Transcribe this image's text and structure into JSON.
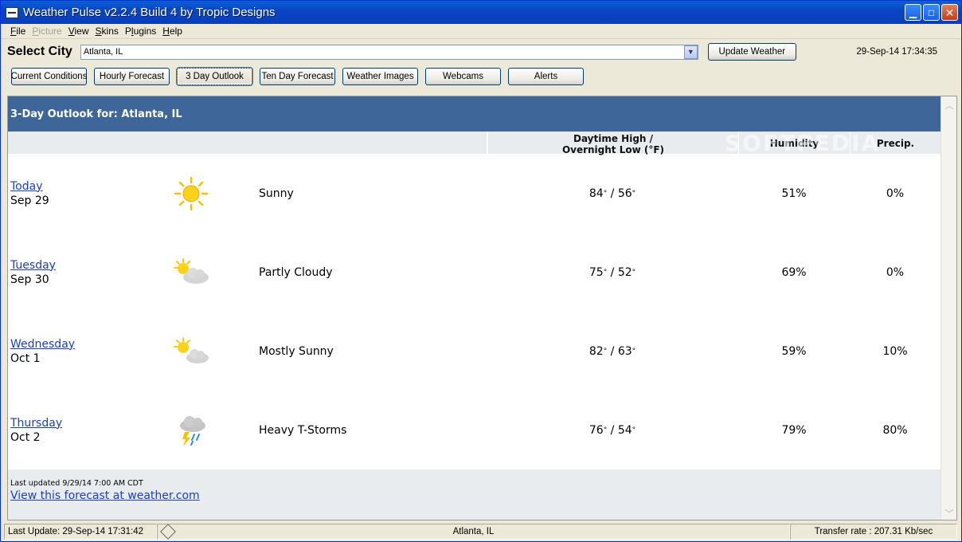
{
  "window": {
    "title": "Weather Pulse v2.2.4 Build 4 by Tropic Designs"
  },
  "menu": {
    "items": [
      {
        "label": "File",
        "ul": "F",
        "rest": "ile",
        "disabled": false
      },
      {
        "label": "Picture",
        "ul": "P",
        "rest": "icture",
        "disabled": true
      },
      {
        "label": "View",
        "ul": "V",
        "rest": "iew",
        "disabled": false
      },
      {
        "label": "Skins",
        "ul": "S",
        "rest": "kins",
        "disabled": false
      },
      {
        "label": "Plugins",
        "ul": "l",
        "pre": "P",
        "rest": "ugins",
        "disabled": false
      },
      {
        "label": "Help",
        "ul": "H",
        "rest": "elp",
        "disabled": false
      }
    ]
  },
  "citybar": {
    "label": "Select City",
    "selected_city": "Atlanta, IL",
    "update_label": "Update Weather",
    "datetime": "29-Sep-14 17:34:35"
  },
  "tabs": [
    {
      "label": "Current Conditions",
      "active": false
    },
    {
      "label": "Hourly Forecast",
      "active": false
    },
    {
      "label": "3 Day Outlook",
      "active": true
    },
    {
      "label": "Ten Day Forecast",
      "active": false
    },
    {
      "label": "Weather Images",
      "active": false
    },
    {
      "label": "Webcams",
      "active": false
    },
    {
      "label": "Alerts",
      "active": false
    }
  ],
  "outlook": {
    "title": "3-Day Outlook for: Atlanta, IL",
    "col_temps_line1": "Daytime High /",
    "col_temps_line2": "Overnight Low (°F)",
    "col_humidity": "Humidity",
    "col_precip": "Precip.",
    "rows": [
      {
        "day": "Today",
        "date": "Sep 29",
        "icon": "sunny-icon",
        "condition": "Sunny",
        "high": "84",
        "low": "56",
        "humidity": "51%",
        "precip": "0%"
      },
      {
        "day": "Tuesday",
        "date": "Sep 30",
        "icon": "partly-cloudy-icon",
        "condition": "Partly Cloudy",
        "high": "75",
        "low": "52",
        "humidity": "69%",
        "precip": "0%"
      },
      {
        "day": "Wednesday",
        "date": "Oct 1",
        "icon": "mostly-sunny-icon",
        "condition": "Mostly Sunny",
        "high": "82",
        "low": "63",
        "humidity": "59%",
        "precip": "10%"
      },
      {
        "day": "Thursday",
        "date": "Oct 2",
        "icon": "thunderstorm-icon",
        "condition": "Heavy T-Storms",
        "high": "76",
        "low": "54",
        "humidity": "79%",
        "precip": "80%"
      }
    ],
    "last_updated": "Last updated 9/29/14 7:00 AM CDT",
    "link_text": "View this forecast at weather.com",
    "watermark": "SOFTPEDIA"
  },
  "status": {
    "last_update": "Last Update: 29-Sep-14 17:31:42",
    "city": "Atlanta, IL",
    "transfer": "Transfer rate : 207.31 Kb/sec"
  },
  "colors": {
    "accent": "#3f6699",
    "link": "#1b3fc4",
    "titlebar": "#0a5fd8"
  }
}
